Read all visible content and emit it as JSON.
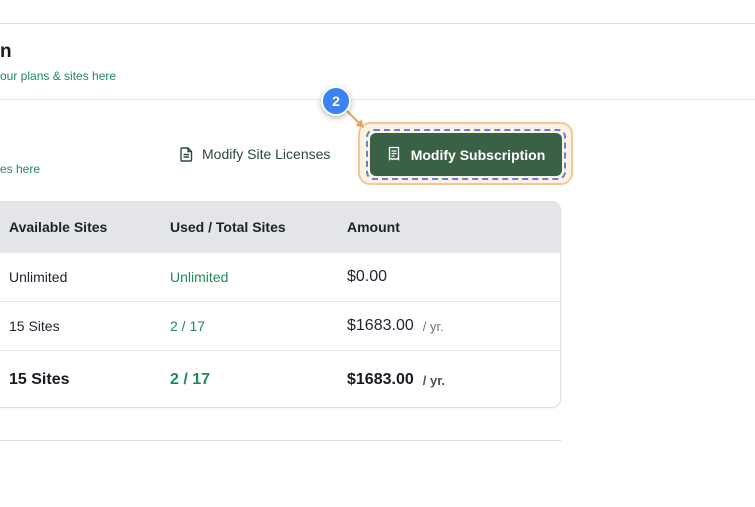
{
  "header": {
    "title": "n",
    "subtitle": "our plans & sites here"
  },
  "section": {
    "subtitle": "es here"
  },
  "actions": {
    "modify_licenses_label": "Modify Site Licenses",
    "modify_subscription_label": "Modify Subscription"
  },
  "walkthrough": {
    "step_number": "2",
    "highlight_color": "#f3c79a",
    "badge_color": "#3b82f6"
  },
  "table": {
    "headers": [
      "Available Sites",
      "Used / Total Sites",
      "Amount"
    ],
    "rows": [
      {
        "available": "Unlimited",
        "used_total": "Unlimited",
        "amount": "$0.00",
        "period": ""
      },
      {
        "available": "15 Sites",
        "used_total": "2 / 17",
        "amount": "$1683.00",
        "period": "/ yr."
      }
    ],
    "total": {
      "available": "15 Sites",
      "used_total": "2 / 17",
      "amount": "$1683.00",
      "period": "/ yr."
    }
  },
  "colors": {
    "accent_green": "#1f8a5a",
    "primary_button": "#3a6046"
  },
  "icons": {
    "licenses": "document-icon",
    "subscription": "receipt-icon"
  }
}
